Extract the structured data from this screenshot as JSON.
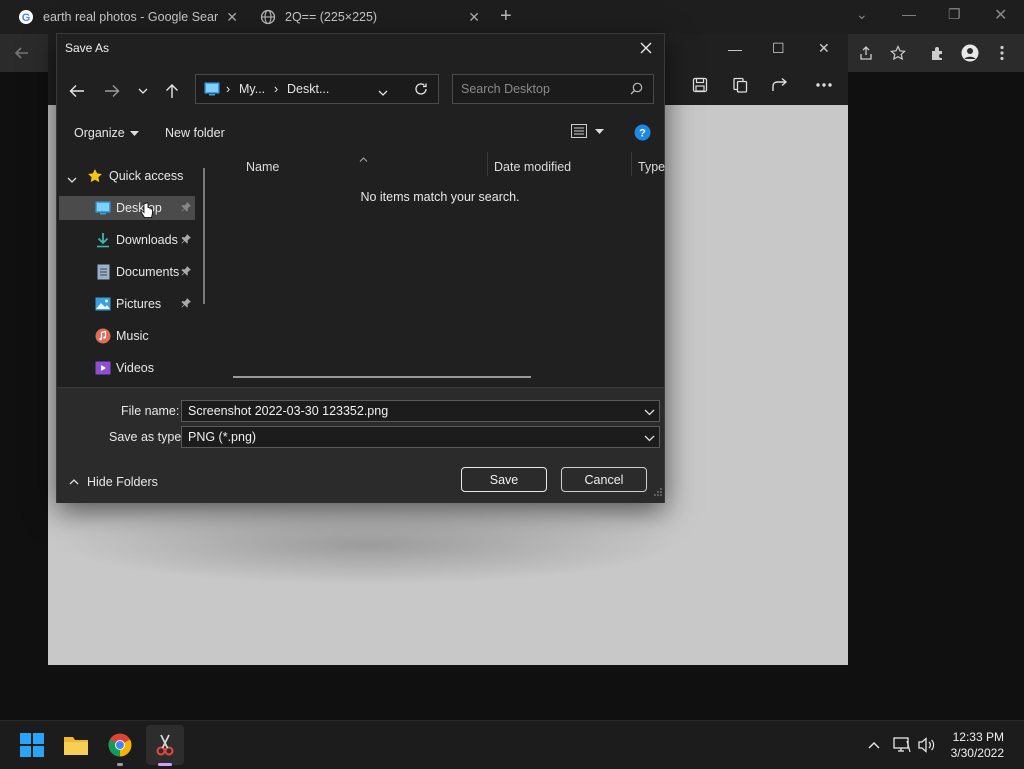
{
  "browser": {
    "tabs": [
      {
        "title": "earth real photos - Google Searc",
        "icon": "google-icon"
      },
      {
        "title": "2Q== (225×225)",
        "icon": "globe-icon"
      }
    ]
  },
  "dialog": {
    "title": "Save As",
    "address": {
      "segments": [
        "My...",
        "Deskt..."
      ]
    },
    "search_placeholder": "Search Desktop",
    "commands": {
      "organize": "Organize",
      "new_folder": "New folder"
    },
    "nav": {
      "group": "Quick access",
      "items": [
        {
          "label": "Desktop",
          "icon": "desktop-icon",
          "pinned": true,
          "selected": true
        },
        {
          "label": "Downloads",
          "icon": "downloads-icon",
          "pinned": true
        },
        {
          "label": "Documents",
          "icon": "documents-icon",
          "pinned": true
        },
        {
          "label": "Pictures",
          "icon": "pictures-icon",
          "pinned": true
        },
        {
          "label": "Music",
          "icon": "music-icon"
        },
        {
          "label": "Videos",
          "icon": "videos-icon"
        }
      ]
    },
    "columns": [
      "Name",
      "Date modified",
      "Type"
    ],
    "empty_message": "No items match your search.",
    "file_name_label": "File name:",
    "file_name_value": "Screenshot 2022-03-30 123352.png",
    "save_type_label": "Save as type:",
    "save_type_value": "PNG (*.png)",
    "hide_folders": "Hide Folders",
    "save_button": "Save",
    "cancel_button": "Cancel"
  },
  "taskbar": {
    "time": "12:33 PM",
    "date": "3/30/2022"
  },
  "colors": {
    "accent_blue": "#0078d4",
    "dialog_bg": "#202020",
    "taskbar_bg": "#1c1c1c"
  }
}
